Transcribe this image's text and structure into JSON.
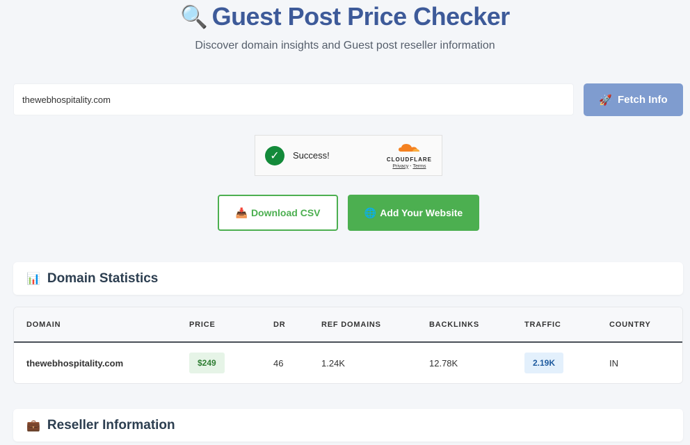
{
  "header": {
    "title": "Guest Post Price Checker",
    "title_icon": "magnifier-icon",
    "subtitle": "Discover domain insights and Guest post reseller information"
  },
  "search": {
    "value": "thewebhospitality.com",
    "fetch_icon": "🚀",
    "fetch_label": "Fetch Info"
  },
  "captcha": {
    "status": "Success!",
    "brand": "CLOUDFLARE",
    "privacy": "Privacy",
    "separator": "·",
    "terms": "Terms"
  },
  "actions": {
    "csv_icon": "📥",
    "csv_label": "Download CSV",
    "add_icon": "🌐",
    "add_label": "Add Your Website"
  },
  "domain_stats": {
    "icon": "📊",
    "title": "Domain Statistics",
    "columns": [
      "DOMAIN",
      "PRICE",
      "DR",
      "REF DOMAINS",
      "BACKLINKS",
      "TRAFFIC",
      "COUNTRY"
    ],
    "rows": [
      {
        "domain": "thewebhospitality.com",
        "price": "$249",
        "dr": "46",
        "ref_domains": "1.24K",
        "backlinks": "12.78K",
        "traffic": "2.19K",
        "country": "IN"
      }
    ]
  },
  "reseller": {
    "icon": "💼",
    "title": "Reseller Information"
  },
  "colors": {
    "title": "#3d5a99",
    "fetch_button": "#7f9ccf",
    "green": "#4caf50",
    "price_badge_bg": "#e6f4e7",
    "traffic_badge_bg": "#e3f0fc"
  }
}
